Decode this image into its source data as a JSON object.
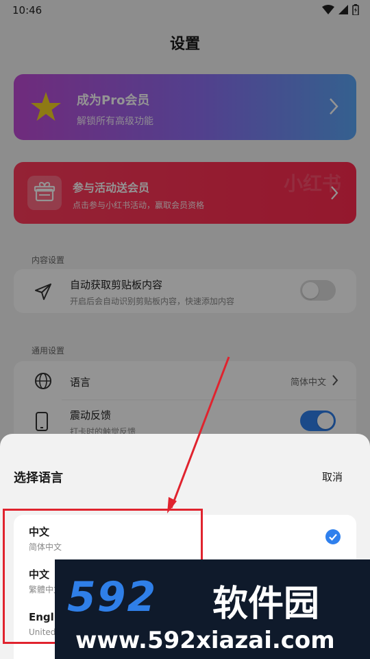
{
  "status_bar": {
    "time": "10:46"
  },
  "page": {
    "title": "设置"
  },
  "pro_card": {
    "title": "成为Pro会员",
    "subtitle": "解锁所有高级功能"
  },
  "promo_card": {
    "title": "参与活动送会员",
    "subtitle": "点击参与小红书活动，赢取会员资格",
    "logo_text": "小红书"
  },
  "content_settings": {
    "label": "内容设置",
    "clipboard": {
      "title": "自动获取剪贴板内容",
      "subtitle": "开启后会自动识别剪贴板内容，快速添加内容",
      "enabled": false
    }
  },
  "general_settings": {
    "label": "通用设置",
    "language": {
      "title": "语言",
      "value": "简体中文"
    },
    "vibration": {
      "title": "震动反馈",
      "subtitle": "打卡时的触觉反馈",
      "enabled": true
    }
  },
  "language_sheet": {
    "title": "选择语言",
    "cancel_label": "取消",
    "options": [
      {
        "title": "中文",
        "subtitle": "简体中文",
        "selected": true
      },
      {
        "title": "中文",
        "subtitle": "繁體中文",
        "selected": false
      },
      {
        "title": "English",
        "subtitle": "United States",
        "selected": false
      }
    ]
  },
  "watermark": {
    "brand_number": "592",
    "brand_cn": "软件园",
    "url": "www.592xiazai.com"
  },
  "colors": {
    "accent": "#2f80ed",
    "annotation": "#e0232e",
    "pro_start": "#c04bd6",
    "pro_end": "#5ba6f6",
    "promo": "#ff2a4f"
  }
}
